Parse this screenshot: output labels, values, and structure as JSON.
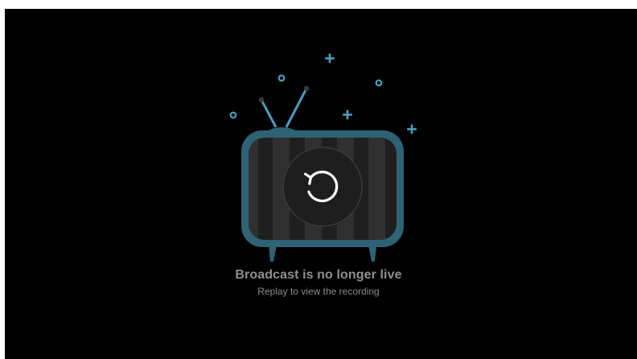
{
  "player": {
    "state": "ended",
    "message": {
      "title": "Broadcast is no longer live",
      "subtitle": "Replay to view the recording"
    },
    "replay_icon": "replay-icon"
  },
  "colors": {
    "background": "#000000",
    "tv_frame": "#2e6275",
    "stripe_dark": "#1f1f1f",
    "stripe_light": "#2f2f2f",
    "accent": "#4a9ec0",
    "text": "#8f8f8f"
  }
}
